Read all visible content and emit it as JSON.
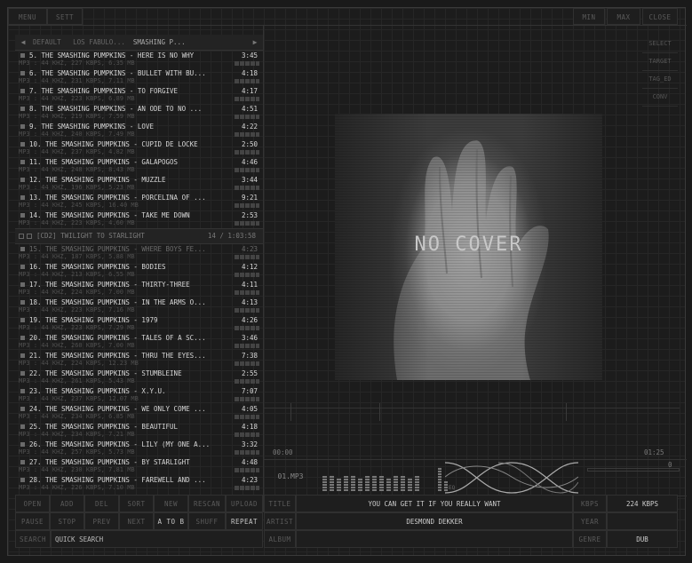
{
  "topbar": {
    "menu": "MENU",
    "sett": "SETT",
    "min": "MIN",
    "max": "MAX",
    "close": "CLOSE"
  },
  "side_buttons": [
    "SELECT",
    "TARGET",
    "TAG_ED",
    "CONV"
  ],
  "breadcrumb": {
    "items": [
      "DEFAULT",
      "LOS FABULO..."
    ],
    "current": "SMASHING P..."
  },
  "playlist": {
    "tracks_a": [
      {
        "title": "5. THE SMASHING PUMPKINS - HERE IS NO WHY",
        "duration": "3:45",
        "info": "MP3 : 44 KHZ, 227 KBPS, 6.35 MB"
      },
      {
        "title": "6. THE SMASHING PUMPKINS - BULLET WITH BU...",
        "duration": "4:18",
        "info": "MP3 : 44 KHZ, 231 KBPS, 7.11 MB"
      },
      {
        "title": "7. THE SMASHING PUMPKINS - TO FORGIVE",
        "duration": "4:17",
        "info": "MP3 : 44 KHZ, 223 KBPS, 6.89 MB"
      },
      {
        "title": "8. THE SMASHING PUMPKINS - AN ODE TO NO ...",
        "duration": "4:51",
        "info": "MP3 : 44 KHZ, 219 KBPS, 7.59 MB"
      },
      {
        "title": "9. THE SMASHING PUMPKINS - LOVE",
        "duration": "4:22",
        "info": "MP3 : 44 KHZ, 240 KBPS, 7.49 MB"
      },
      {
        "title": "10. THE SMASHING PUMPKINS - CUPID DE LOCKE",
        "duration": "2:50",
        "info": "MP3 : 44 KHZ, 237 KBPS, 4.82 MB"
      },
      {
        "title": "11. THE SMASHING PUMPKINS - GALAPOGOS",
        "duration": "4:46",
        "info": "MP3 : 44 KHZ, 248 KBPS, 8.43 MB"
      },
      {
        "title": "12. THE SMASHING PUMPKINS - MUZZLE",
        "duration": "3:44",
        "info": "MP3 : 44 KHZ, 196 KBPS, 5.23 MB"
      },
      {
        "title": "13. THE SMASHING PUMPKINS - PORCELINA OF ...",
        "duration": "9:21",
        "info": "MP3 : 44 KHZ, 245 KBPS, 16.40 MB"
      },
      {
        "title": "14. THE SMASHING PUMPKINS - TAKE ME DOWN",
        "duration": "2:53",
        "info": "MP3 : 44 KHZ, 223 KBPS, 4.60 MB"
      }
    ],
    "cd2_label": "[CD2] TWILIGHT TO STARLIGHT",
    "cd2_total": "14 / 1:03:58",
    "tracks_b": [
      {
        "title": "15. THE SMASHING PUMPKINS - WHERE BOYS FE...",
        "duration": "4:23",
        "info": "MP3 : 44 KHZ, 187 KBPS, 5.88 MB",
        "dim": true
      },
      {
        "title": "16. THE SMASHING PUMPKINS - BODIES",
        "duration": "4:12",
        "info": "MP3 : 44 KHZ, 213 KBPS, 6.55 MB"
      },
      {
        "title": "17. THE SMASHING PUMPKINS - THIRTY-THREE",
        "duration": "4:11",
        "info": "MP3 : 44 KHZ, 224 KBPS, 7.00 MB"
      },
      {
        "title": "18. THE SMASHING PUMPKINS - IN THE ARMS O...",
        "duration": "4:13",
        "info": "MP3 : 44 KHZ, 223 KBPS, 7.16 MB"
      },
      {
        "title": "19. THE SMASHING PUMPKINS - 1979",
        "duration": "4:26",
        "info": "MP3 : 44 KHZ, 223 KBPS, 7.29 MB"
      },
      {
        "title": "20. THE SMASHING PUMPKINS - TALES OF A SC...",
        "duration": "3:46",
        "info": "MP3 : 44 KHZ, 260 KBPS, 7.00 MB"
      },
      {
        "title": "21. THE SMASHING PUMPKINS - THRU THE EYES...",
        "duration": "7:38",
        "info": "MP3 : 44 KHZ, 224 KBPS, 12.23 MB"
      },
      {
        "title": "22. THE SMASHING PUMPKINS - STUMBLEINE",
        "duration": "2:55",
        "info": "MP3 : 44 KHZ, 261 KBPS, 5.43 MB"
      },
      {
        "title": "23. THE SMASHING PUMPKINS - X.Y.U.",
        "duration": "7:07",
        "info": "MP3 : 44 KHZ, 237 KBPS, 12.07 MB"
      },
      {
        "title": "24. THE SMASHING PUMPKINS - WE ONLY COME ...",
        "duration": "4:05",
        "info": "MP3 : 44 KHZ, 234 KBPS, 6.85 MB"
      },
      {
        "title": "25. THE SMASHING PUMPKINS - BEAUTIFUL",
        "duration": "4:18",
        "info": "MP3 : 44 KHZ, 234 KBPS, 7.21 MB"
      },
      {
        "title": "26. THE SMASHING PUMPKINS - LILY (MY ONE A...",
        "duration": "3:32",
        "info": "MP3 : 44 KHZ, 257 KBPS, 5.73 MB"
      },
      {
        "title": "27. THE SMASHING PUMPKINS - BY STARLIGHT",
        "duration": "4:48",
        "info": "MP3 : 44 KHZ, 230 KBPS, 7.81 MB"
      },
      {
        "title": "28. THE SMASHING PUMPKINS - FAREWELL AND ...",
        "duration": "4:23",
        "info": "MP3 : 44 KHZ, 226 KBPS, 7.10 MB"
      }
    ]
  },
  "cover": {
    "text": "NO COVER"
  },
  "player": {
    "time_elapsed": "00:00",
    "time_total": "01:25",
    "filename": "01.MP3",
    "eq_label": "EQ",
    "eq_levels": [
      0.55,
      0.6,
      0.5,
      0.55,
      0.6,
      0.5,
      0.55,
      0.6,
      0.55,
      0.5,
      0.6,
      0.55,
      0.5,
      0.55
    ],
    "eq_side_levels": [
      0.9,
      0.35
    ],
    "balance_value": "0"
  },
  "controls_row1": [
    "OPEN",
    "ADD",
    "DEL",
    "SORT",
    "NEW",
    "RESCAN",
    "UPLOAD"
  ],
  "controls_row2": [
    "PAUSE",
    "STOP",
    "PREV",
    "NEXT",
    "A TO B",
    "SHUFF",
    "REPEAT"
  ],
  "search": {
    "label": "SEARCH",
    "value": "QUICK SEARCH"
  },
  "tags": {
    "title_label": "TITLE",
    "title_value": "YOU CAN GET IT IF YOU REALLY WANT",
    "artist_label": "ARTIST",
    "artist_value": "DESMOND DEKKER",
    "album_label": "ALBUM",
    "album_value": "",
    "kbps_label": "KBPS",
    "kbps_value": "224 KBPS",
    "year_label": "YEAR",
    "year_value": "",
    "genre_label": "GENRE",
    "genre_value": "DUB"
  }
}
